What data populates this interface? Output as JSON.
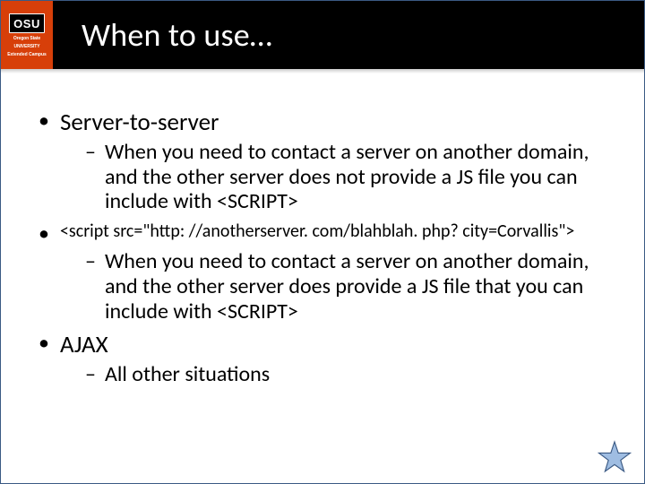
{
  "logo": {
    "abbr": "OSU",
    "line1": "Oregon State",
    "line2": "UNIVERSITY",
    "line3": "Extended Campus"
  },
  "title": "When to use…",
  "bullets": {
    "b1": "Server-to-server",
    "b1_sub1": "When you need to contact a server on another domain, and the other server does not provide a JS file you can include with <SCRIPT>",
    "b2": "<script src=\"http: //anotherserver. com/blahblah. php? city=Corvallis\">",
    "b2_sub1": "When you need to contact a server on another domain, and the other server does provide a JS file that you can include with <SCRIPT>",
    "b3": "AJAX",
    "b3_sub1": "All other situations"
  }
}
